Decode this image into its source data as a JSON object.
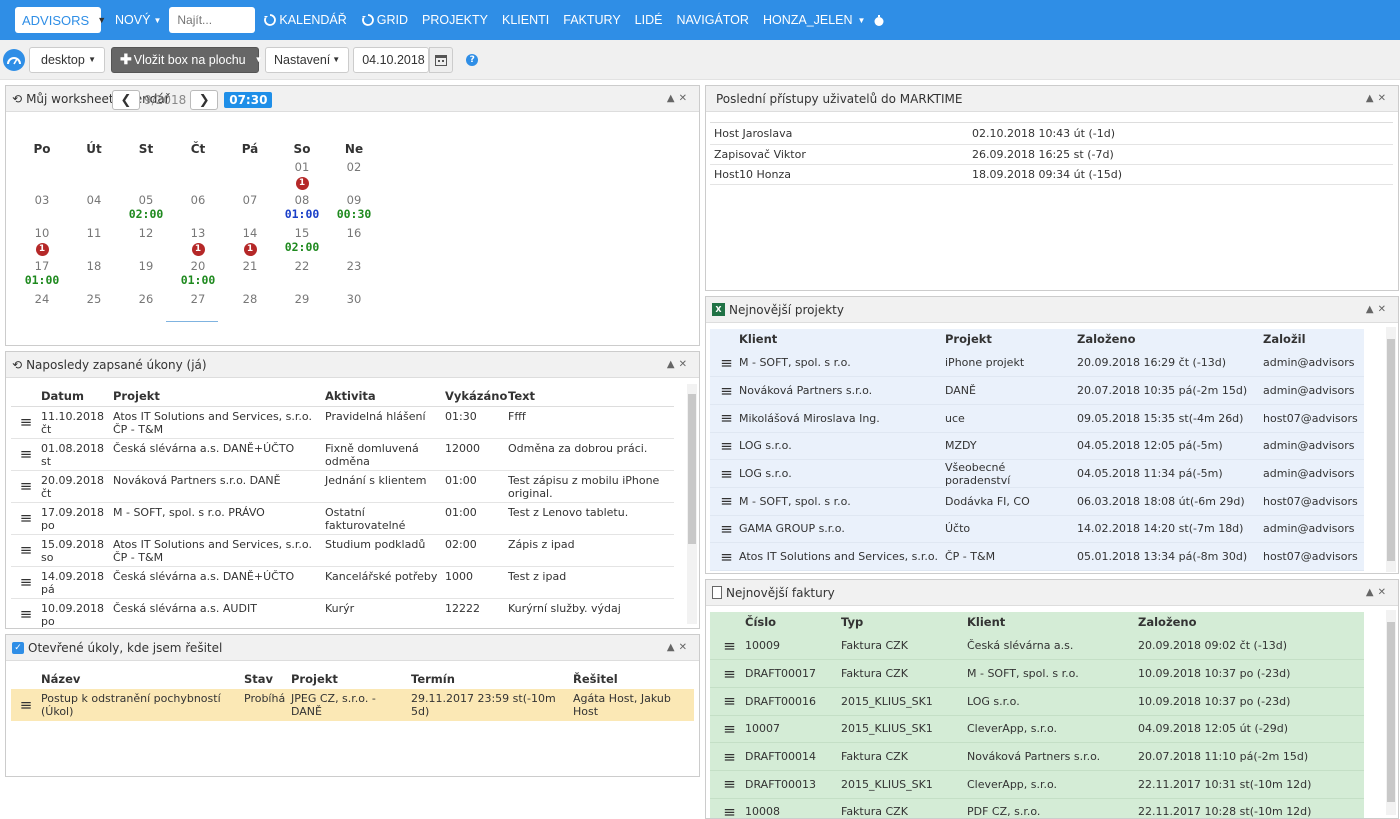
{
  "topnav": {
    "brand": "ADVISORS",
    "new": "NOVÝ",
    "search_placeholder": "Najít...",
    "links": [
      "KALENDÁŘ",
      "GRID",
      "PROJEKTY",
      "KLIENTI",
      "FAKTURY",
      "LIDÉ",
      "NAVIGÁTOR",
      "HONZA_JELEN"
    ]
  },
  "toolbar": {
    "desktop": "desktop",
    "add_box": "Vložit box na plochu",
    "settings": "Nastavení",
    "date": "04.10.2018"
  },
  "calendar": {
    "title": "Můj worksheet kalendář",
    "month": "9/2018",
    "time": "07:30",
    "days": [
      "Po",
      "Út",
      "St",
      "Čt",
      "Pá",
      "So",
      "Ne"
    ],
    "weeks": [
      [
        {
          "d": ""
        },
        {
          "d": ""
        },
        {
          "d": ""
        },
        {
          "d": ""
        },
        {
          "d": ""
        },
        {
          "d": "01",
          "b": "1"
        },
        {
          "d": "02"
        }
      ],
      [
        {
          "d": "03"
        },
        {
          "d": "04"
        },
        {
          "d": "05",
          "t": "02:00",
          "c": "green"
        },
        {
          "d": "06"
        },
        {
          "d": "07"
        },
        {
          "d": "08",
          "t": "01:00",
          "c": "blue"
        },
        {
          "d": "09",
          "t": "00:30",
          "c": "green"
        }
      ],
      [
        {
          "d": "10",
          "b": "1"
        },
        {
          "d": "11"
        },
        {
          "d": "12"
        },
        {
          "d": "13",
          "b": "1"
        },
        {
          "d": "14",
          "b": "1"
        },
        {
          "d": "15",
          "t": "02:00",
          "c": "green"
        },
        {
          "d": "16"
        }
      ],
      [
        {
          "d": "17",
          "t": "01:00",
          "c": "green"
        },
        {
          "d": "18"
        },
        {
          "d": "19"
        },
        {
          "d": "20",
          "t": "01:00",
          "c": "green"
        },
        {
          "d": "21"
        },
        {
          "d": "22"
        },
        {
          "d": "23"
        }
      ],
      [
        {
          "d": "24"
        },
        {
          "d": "25"
        },
        {
          "d": "26"
        },
        {
          "d": "27"
        },
        {
          "d": "28"
        },
        {
          "d": "29"
        },
        {
          "d": "30"
        }
      ]
    ]
  },
  "recent": {
    "title": "Naposledy zapsané úkony (já)",
    "headers": [
      "Datum",
      "Projekt",
      "Aktivita",
      "Vykázáno",
      "Text"
    ],
    "rows": [
      [
        "11.10.2018 čt",
        "Atos IT Solutions and Services, s.r.o. ČP - T&M",
        "Pravidelná hlášení",
        "01:30",
        "Ffff"
      ],
      [
        "01.08.2018 st",
        "Česká slévárna a.s. DANĚ+ÚČTO",
        "Fixně domluvená odměna",
        "12000",
        "Odměna za dobrou práci."
      ],
      [
        "20.09.2018 čt",
        "Nováková Partners s.r.o. DANĚ",
        "Jednání s klientem",
        "01:00",
        "Test zápisu z mobilu iPhone original."
      ],
      [
        "17.09.2018 po",
        "M - SOFT, spol. s r.o. PRÁVO",
        "Ostatní fakturovatelné",
        "01:00",
        "Test z Lenovo tabletu."
      ],
      [
        "15.09.2018 so",
        "Atos IT Solutions and Services, s.r.o. ČP - T&M",
        "Studium podkladů",
        "02:00",
        "Zápis z ipad"
      ],
      [
        "14.09.2018 pá",
        "Česká slévárna a.s. DANĚ+ÚČTO",
        "Kancelářské potřeby",
        "1000",
        "Test z ipad"
      ],
      [
        "10.09.2018 po",
        "Česká slévárna a.s. AUDIT",
        "Kurýr",
        "12222",
        "Kurýrní služby. výdaj"
      ]
    ]
  },
  "tasks": {
    "title": "Otevřené úkoly, kde jsem řešitel",
    "headers": [
      "Název",
      "Stav",
      "Projekt",
      "Termín",
      "Řešitel"
    ],
    "rows": [
      [
        "Postup k odstranění pochybností (Úkol)",
        "Probíhá",
        "JPEG CZ, s.r.o. - DANĚ",
        "29.11.2017 23:59 st(-10m 5d)",
        "Agáta Host, Jakub Host"
      ]
    ]
  },
  "access": {
    "title": "Poslední přístupy uživatelů do MARKTIME",
    "rows": [
      [
        "Host Jaroslava",
        "02.10.2018 10:43 út (-1d)"
      ],
      [
        "Zapisovač Viktor",
        "26.09.2018 16:25 st (-7d)"
      ],
      [
        "Host10 Honza",
        "18.09.2018 09:34 út (-15d)"
      ]
    ]
  },
  "projects": {
    "title": "Nejnovější projekty",
    "headers": [
      "Klient",
      "Projekt",
      "Založeno",
      "Založil"
    ],
    "rows": [
      [
        "M - SOFT, spol. s r.o.",
        "iPhone projekt",
        "20.09.2018 16:29 čt (-13d)",
        "admin@advisors"
      ],
      [
        "Nováková Partners s.r.o.",
        "DANĚ",
        "20.07.2018 10:35 pá(-2m 15d)",
        "admin@advisors"
      ],
      [
        "Mikolášová Miroslava Ing.",
        "uce",
        "09.05.2018 15:35 st(-4m 26d)",
        "host07@advisors"
      ],
      [
        "LOG s.r.o.",
        "MZDY",
        "04.05.2018 12:05 pá(-5m)",
        "admin@advisors"
      ],
      [
        "LOG s.r.o.",
        "Všeobecné poradenství",
        "04.05.2018 11:34 pá(-5m)",
        "admin@advisors"
      ],
      [
        "M - SOFT, spol. s r.o.",
        "Dodávka FI, CO",
        "06.03.2018 18:08 út(-6m 29d)",
        "host07@advisors"
      ],
      [
        "GAMA GROUP s.r.o.",
        "Účto",
        "14.02.2018 14:20 st(-7m 18d)",
        "admin@advisors"
      ],
      [
        "Atos IT Solutions and Services, s.r.o.",
        "ČP - T&M",
        "05.01.2018 13:34 pá(-8m 30d)",
        "host07@advisors"
      ]
    ]
  },
  "invoices": {
    "title": "Nejnovější faktury",
    "headers": [
      "Číslo",
      "Typ",
      "Klient",
      "Založeno"
    ],
    "rows": [
      [
        "10009",
        "Faktura CZK",
        "Česká slévárna a.s.",
        "20.09.2018 09:02 čt (-13d)"
      ],
      [
        "DRAFT00017",
        "Faktura CZK",
        "M - SOFT, spol. s r.o.",
        "10.09.2018 10:37 po (-23d)"
      ],
      [
        "DRAFT00016",
        "2015_KLIUS_SK1",
        "LOG s.r.o.",
        "10.09.2018 10:37 po (-23d)"
      ],
      [
        "10007",
        "2015_KLIUS_SK1",
        "CleverApp, s.r.o.",
        "04.09.2018 12:05 út (-29d)"
      ],
      [
        "DRAFT00014",
        "Faktura CZK",
        "Nováková Partners s.r.o.",
        "20.07.2018 11:10 pá(-2m 15d)"
      ],
      [
        "DRAFT00013",
        "2015_KLIUS_SK1",
        "CleverApp, s.r.o.",
        "22.11.2017 10:31 st(-10m 12d)"
      ],
      [
        "10008",
        "Faktura CZK",
        "PDF CZ, s.r.o.",
        "22.11.2017 10:28 st(-10m 12d)"
      ]
    ]
  },
  "colors": {
    "nav": "#2f8ee6",
    "calendar_green": "#1f8a1f",
    "calendar_blue": "#1a3fc8",
    "badge_red": "#b52828",
    "project_rows": "#eaf1fb",
    "invoice_rows": "#d4ecd6",
    "task_row": "#fbe8b5"
  }
}
